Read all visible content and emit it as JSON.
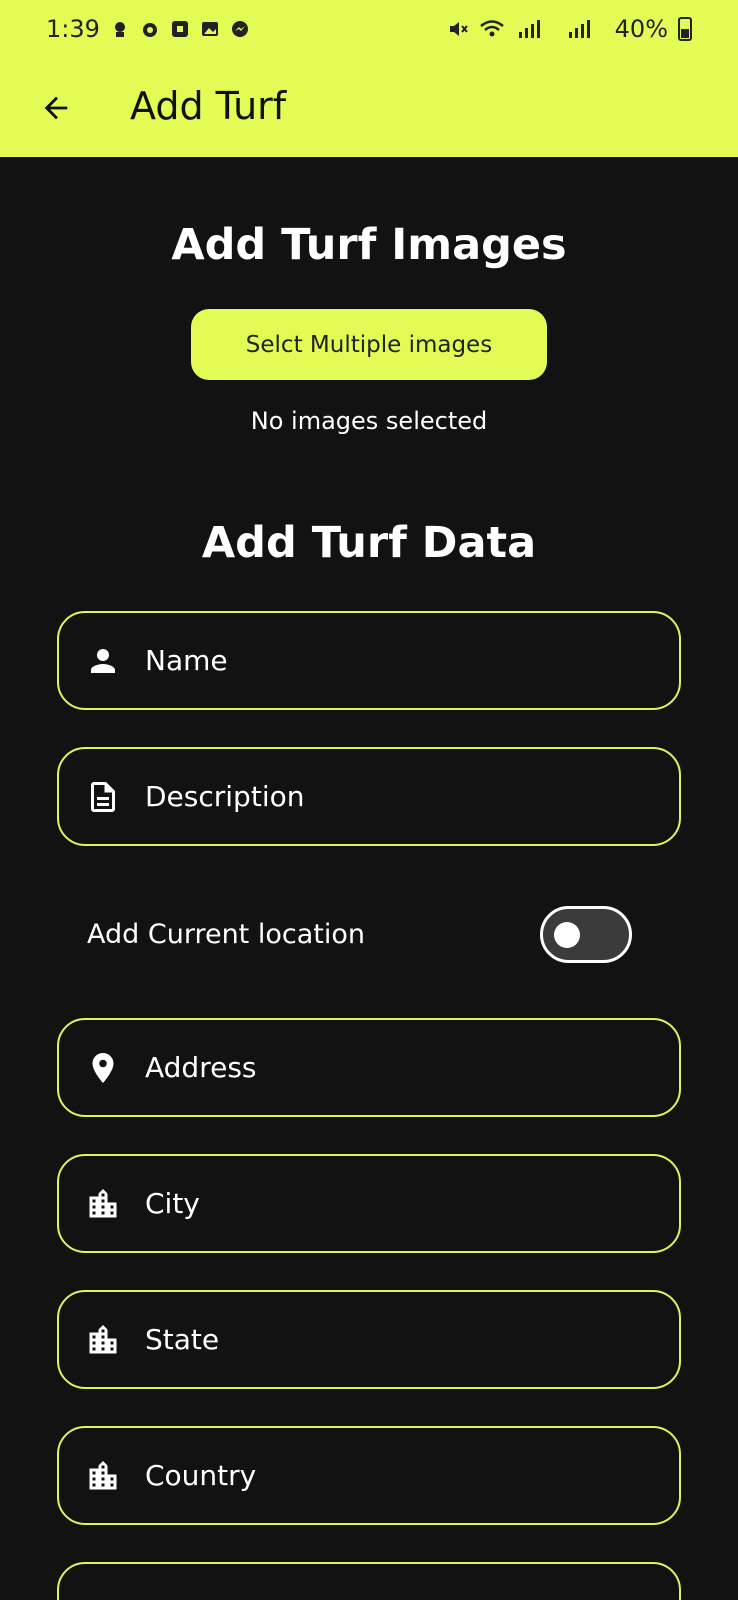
{
  "status_bar": {
    "time": "1:39",
    "battery": "40%"
  },
  "app_bar": {
    "title": "Add Turf"
  },
  "images_section": {
    "title": "Add Turf Images",
    "select_button": "Selct Multiple images",
    "empty_text": "No images selected"
  },
  "data_section": {
    "title": "Add Turf Data"
  },
  "fields": {
    "name": {
      "placeholder": "Name",
      "icon": "person-icon"
    },
    "description": {
      "placeholder": "Description",
      "icon": "document-icon"
    },
    "address": {
      "placeholder": "Address",
      "icon": "location-pin-icon"
    },
    "city": {
      "placeholder": "City",
      "icon": "city-icon"
    },
    "state": {
      "placeholder": "State",
      "icon": "city-icon"
    },
    "country": {
      "placeholder": "Country",
      "icon": "city-icon"
    }
  },
  "location_toggle": {
    "label": "Add Current location",
    "value": false
  },
  "colors": {
    "accent": "#e2fb55",
    "background": "#121212",
    "field_border": "#dff45a"
  }
}
